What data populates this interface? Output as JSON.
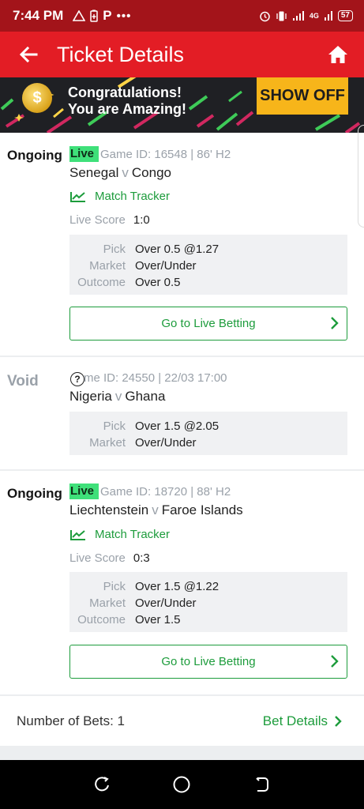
{
  "status_bar": {
    "time": "7:44 PM",
    "left_icons": [
      "warning-icon",
      "battery-saver-icon",
      "p-icon"
    ],
    "dots": "•••",
    "network": "4G",
    "battery": "57"
  },
  "app_bar": {
    "title": "Ticket Details"
  },
  "banner": {
    "line1": "Congratulations!",
    "line2": "You are Amazing!",
    "button": "SHOW OFF",
    "coin_symbol": "$"
  },
  "tickets": [
    {
      "status": "Ongoing",
      "live": "Live",
      "game_meta": "Game ID: 16548 | 86' H2",
      "home": "Senegal",
      "vs": "v",
      "away": "Congo",
      "tracker": "Match Tracker",
      "live_score_label": "Live Score",
      "live_score": "1:0",
      "pick_label": "Pick",
      "pick": "Over 0.5 @1.27",
      "market_label": "Market",
      "market": "Over/Under",
      "outcome_label": "Outcome",
      "outcome": "Over 0.5",
      "button": "Go to Live Betting"
    },
    {
      "status": "Void",
      "game_meta": "me ID: 24550 | 22/03 17:00",
      "home": "Nigeria",
      "vs": "v",
      "away": "Ghana",
      "pick_label": "Pick",
      "pick": "Over 1.5 @2.05",
      "market_label": "Market",
      "market": "Over/Under"
    },
    {
      "status": "Ongoing",
      "live": "Live",
      "game_meta": "Game ID: 18720 | 88' H2",
      "home": "Liechtenstein",
      "vs": "v",
      "away": "Faroe Islands",
      "tracker": "Match Tracker",
      "live_score_label": "Live Score",
      "live_score": "0:3",
      "pick_label": "Pick",
      "pick": "Over 1.5 @1.22",
      "market_label": "Market",
      "market": "Over/Under",
      "outcome_label": "Outcome",
      "outcome": "Over 1.5",
      "button": "Go to Live Betting"
    }
  ],
  "footer": {
    "bets_count": "Number of Bets: 1",
    "bet_details": "Bet Details"
  },
  "colors": {
    "status_bar": "#a3141a",
    "app_bar": "#e31d25",
    "accent_green": "#1d9c3c",
    "live_badge": "#3fe07a",
    "show_off": "#f7b51a"
  }
}
